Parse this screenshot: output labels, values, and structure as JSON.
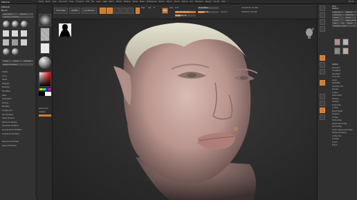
{
  "app": {
    "title": "Material",
    "top_right": "ZBrush"
  },
  "menubar": [
    "Alpha",
    "Brush",
    "Color",
    "Document",
    "Draw",
    "Dynamics",
    "Edit",
    "File",
    "Layer",
    "Light",
    "Macro",
    "Marker",
    "Material",
    "Movie",
    "Picker",
    "Preferences",
    "Render",
    "Stencil",
    "Stroke",
    "Texture",
    "Tool",
    "Transform",
    "Zplugin",
    "Zscript",
    "Help"
  ],
  "left_panel": {
    "title": "Material",
    "subtitle": "Brush",
    "buttons": [
      "Load Brush",
      "Save As",
      "Lightbox > Brushes",
      "Clone",
      "Brush",
      "BrushSel",
      "Reset All Brushes"
    ],
    "items": [
      "Create",
      "Curve",
      "Depth",
      "Samples",
      "Elasticity",
      "FiberMesh",
      "Twist",
      "Orientation",
      "Surface",
      "Modifiers",
      "Sculptris Pro",
      "Auto Masking",
      "Tablet Pressure",
      "Alpha and Texture",
      "Clip Brush Modifiers",
      "Smooth Brush Modifiers",
      "SnakeHook Modifiers",
      "Reset Current Brush",
      "Reset All Brushes"
    ]
  },
  "tool_column": {
    "labels": [
      "Switch Color",
      "Gradient"
    ]
  },
  "toolbar": {
    "home_page": "Home Page",
    "lightbox": "LightBox",
    "live_boolean": "Live Boolean",
    "buttons": [
      "Edit",
      "Draw",
      "Move",
      "Scale",
      "Rotate"
    ],
    "mrgb": "Mrgb",
    "rgb": "Rgb",
    "m": "M",
    "zadd": "Zadd",
    "zsub": "Zsub",
    "zcut": "Zcut",
    "focal_shift": "Focal Shift 0",
    "draw_size": "Draw Size 64",
    "rgb_intensity": "Rgb Intensity 100",
    "z_intensity": "Z Intensity 25",
    "dynamic": "Dynamic",
    "active_points": "ActivePoints: 415,648",
    "total_points": "TotalPoints: 415,648",
    "rgb_fill": 1.0,
    "z_fill": 0.25
  },
  "right_tray": {
    "title": "Tool",
    "subtitle": "Subtool",
    "buttons": [
      "Load Tool",
      "Save As",
      "Copy Tool",
      "Paste Tool",
      "Import",
      "Export",
      "Clone",
      "Make PolyMesh3D",
      "GoZ",
      "All",
      "Visible",
      "R",
      "Lightbox > Tools"
    ],
    "items": [
      "Subtool",
      "Geometry",
      "ArrayMesh",
      "NanoMesh",
      "Thick Skin",
      "Layers",
      "FiberMesh",
      "Geometry HD",
      "Preview",
      "Surface",
      "Deformation",
      "Masking",
      "Visibility",
      "Polygroups",
      "Contact",
      "Morph Target",
      "Polypaint",
      "UV Map",
      "Texture Map",
      "Displacement Map",
      "Normal Map",
      "Vector Displacement Map",
      "Display Properties",
      "Unified Skin",
      "Initialize",
      "Import",
      "Export"
    ]
  },
  "colors": {
    "accent": "#d47b2b",
    "panel": "#323232",
    "background": "#1f1f1f"
  }
}
